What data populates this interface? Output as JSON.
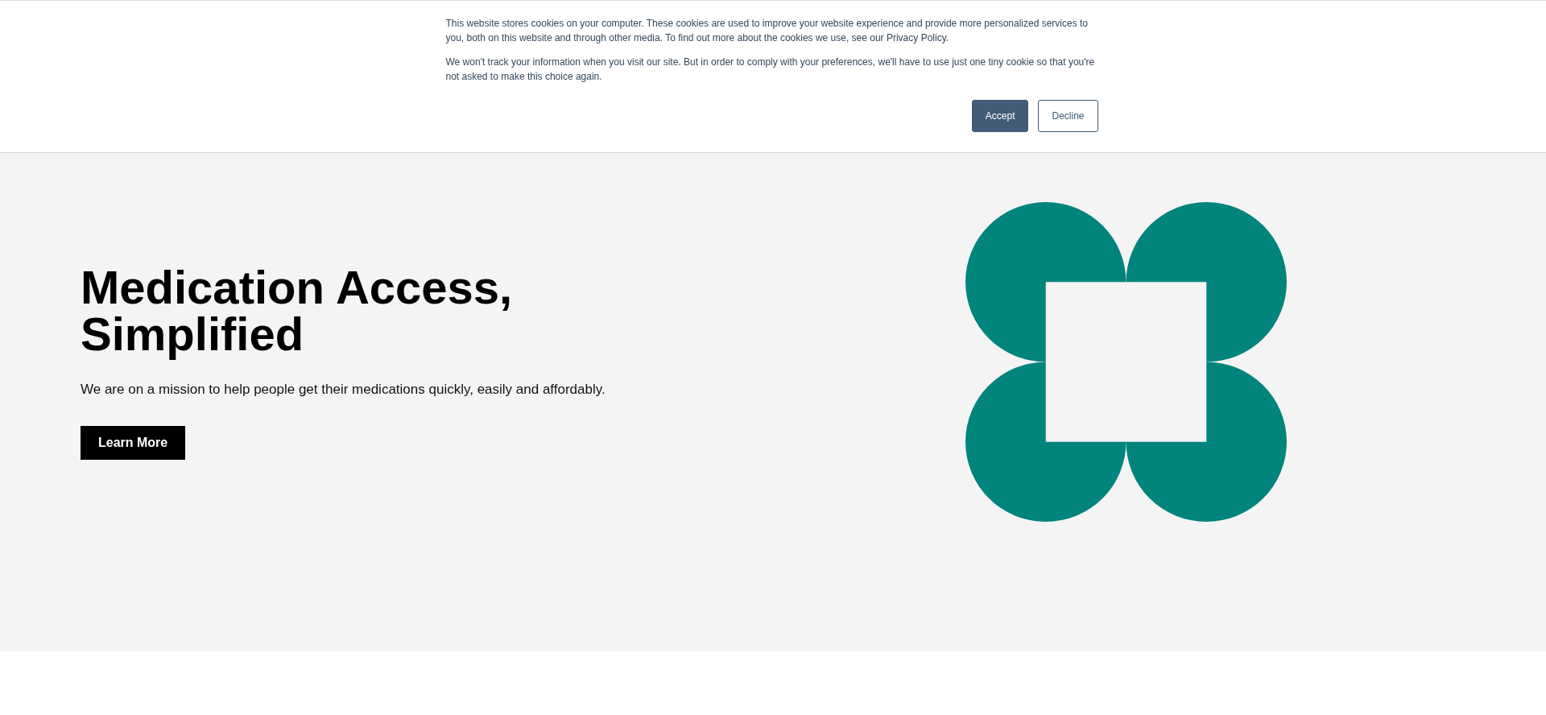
{
  "cookie_banner": {
    "paragraphs": [
      "This website stores cookies on your computer. These cookies are used to improve your website experience and provide more personalized services to you, both on this website and through other media. To find out more about the cookies we use, see our Privacy Policy.",
      "We won't track your information when you visit our site. But in order to comply with your preferences, we'll have to use just one tiny cookie so that you're not asked to make this choice again."
    ],
    "buttons": [
      {
        "label": "Accept",
        "kind": "primary"
      },
      {
        "label": "Decline",
        "kind": "secondary"
      }
    ]
  },
  "hero": {
    "heading": "Medication Access, Simplified",
    "subtitle": "We are on a mission to help people get their medications quickly, easily and affordably.",
    "button": "Learn More"
  }
}
